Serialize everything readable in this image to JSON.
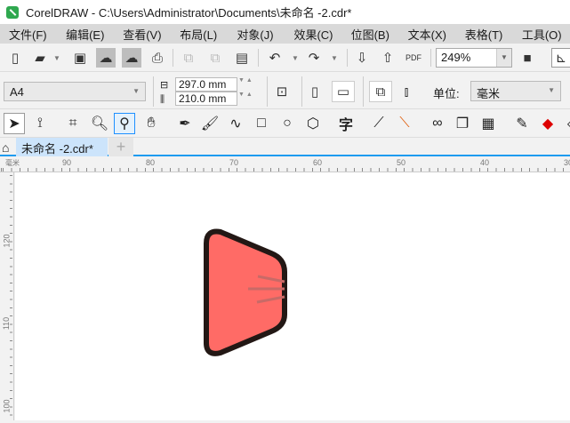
{
  "window": {
    "title": "CorelDRAW - C:\\Users\\Administrator\\Documents\\未命名 -2.cdr*"
  },
  "menu": [
    "文件(F)",
    "编辑(E)",
    "查看(V)",
    "布局(L)",
    "对象(J)",
    "效果(C)",
    "位图(B)",
    "文本(X)",
    "表格(T)",
    "工具(O)"
  ],
  "toolbar": {
    "zoom": "249%",
    "pdf_label": "PDF"
  },
  "propbar": {
    "page_size": "A4",
    "width": "297.0 mm",
    "height": "210.0 mm",
    "units_label": "单位:",
    "units": "毫米"
  },
  "tabs": {
    "document": "未命名 -2.cdr*",
    "new": "+"
  },
  "rulers": {
    "horizontal": [
      "90",
      "80",
      "70",
      "60",
      "50",
      "40",
      "30"
    ],
    "vertical": [
      "120",
      "110",
      "100"
    ],
    "unit": "毫米"
  },
  "colors": {
    "shape_fill": "#ff6b66",
    "shape_outline": "#231815",
    "active_tab": "#cce4fb",
    "accent": "#1e9bef"
  }
}
